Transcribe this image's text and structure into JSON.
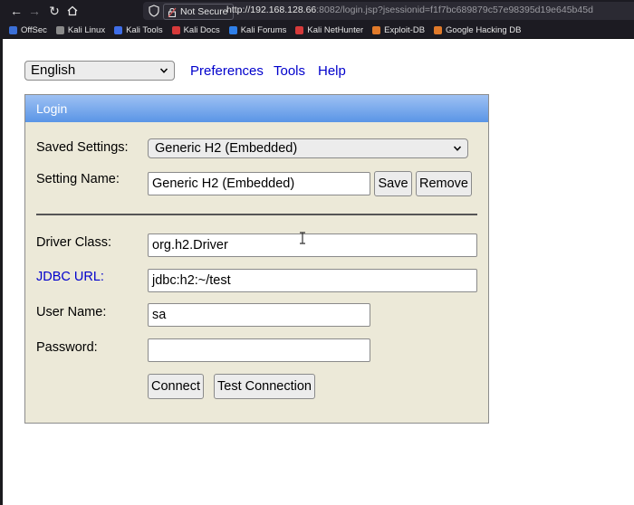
{
  "browser": {
    "url_host": "http://192.168.128.66",
    "url_rest": ":8082/login.jsp?jsessionid=f1f7bc689879c57e98395d19e645b45d",
    "security_label": "Not Secure",
    "bookmarks": [
      {
        "label": "OffSec",
        "color": "#3b6fd6"
      },
      {
        "label": "Kali Linux",
        "color": "#8a8a8a"
      },
      {
        "label": "Kali Tools",
        "color": "#3f6ee8"
      },
      {
        "label": "Kali Docs",
        "color": "#d63a3a"
      },
      {
        "label": "Kali Forums",
        "color": "#2f7fe8"
      },
      {
        "label": "Kali NetHunter",
        "color": "#d63a3a"
      },
      {
        "label": "Exploit-DB",
        "color": "#e07a2a"
      },
      {
        "label": "Google Hacking DB",
        "color": "#e07a2a"
      }
    ]
  },
  "topbar": {
    "language": "English",
    "links": [
      "Preferences",
      "Tools",
      "Help"
    ]
  },
  "login": {
    "header": "Login",
    "saved_settings_label": "Saved Settings:",
    "saved_settings_value": "Generic H2 (Embedded)",
    "setting_name_label": "Setting Name:",
    "setting_name_value": "Generic H2 (Embedded)",
    "save_label": "Save",
    "remove_label": "Remove",
    "driver_class_label": "Driver Class:",
    "driver_class_value": "org.h2.Driver",
    "jdbc_url_label": "JDBC URL:",
    "jdbc_url_value": "jdbc:h2:~/test",
    "user_name_label": "User Name:",
    "user_name_value": "sa",
    "password_label": "Password:",
    "password_value": "",
    "connect_label": "Connect",
    "test_connection_label": "Test Connection"
  }
}
